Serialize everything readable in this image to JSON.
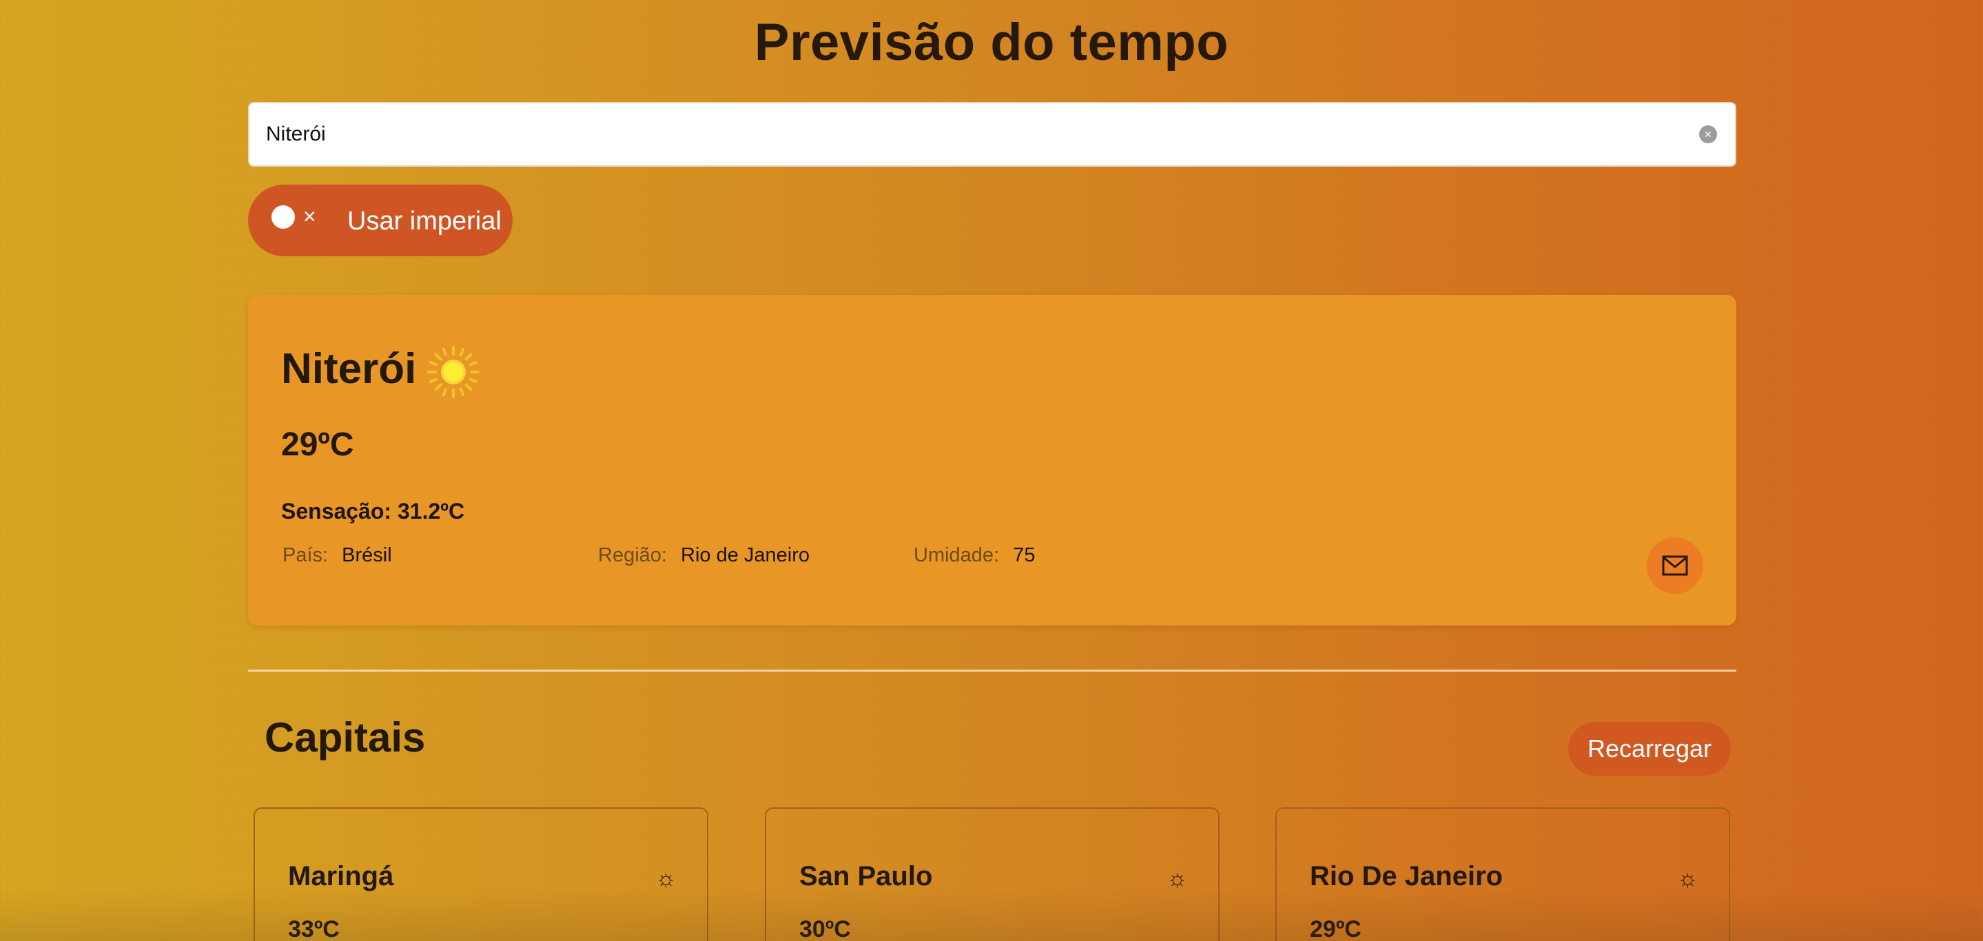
{
  "header": {
    "title": "Previsão do tempo"
  },
  "search": {
    "value": "Niterói",
    "placeholder": ""
  },
  "toggle": {
    "label": "Usar imperial",
    "checked": false,
    "off_symbol": "×"
  },
  "current": {
    "city": "Niterói",
    "icon": "sun-icon",
    "temperature": "29ºC",
    "feels_like": "Sensação: 31.2ºC",
    "country_label": "País",
    "country": "Brésil",
    "region_label": "Região",
    "region": "Rio de Janeiro",
    "humidity_label": "Umidade",
    "humidity": "75",
    "separator": ":"
  },
  "capitals": {
    "title": "Capitais",
    "reload_label": "Recarregar",
    "items": [
      {
        "name": "Maringá",
        "temp": "33ºC",
        "icon": "sun-icon"
      },
      {
        "name": "San Paulo",
        "temp": "30ºC",
        "icon": "sun-icon"
      },
      {
        "name": "Rio De Janeiro",
        "temp": "29ºC",
        "icon": "sun-icon"
      }
    ]
  },
  "colors": {
    "background_start": "#d6a521",
    "background_end": "#d1661f",
    "card": "#e89625",
    "button": "#cf5524",
    "text": "#22180b"
  }
}
